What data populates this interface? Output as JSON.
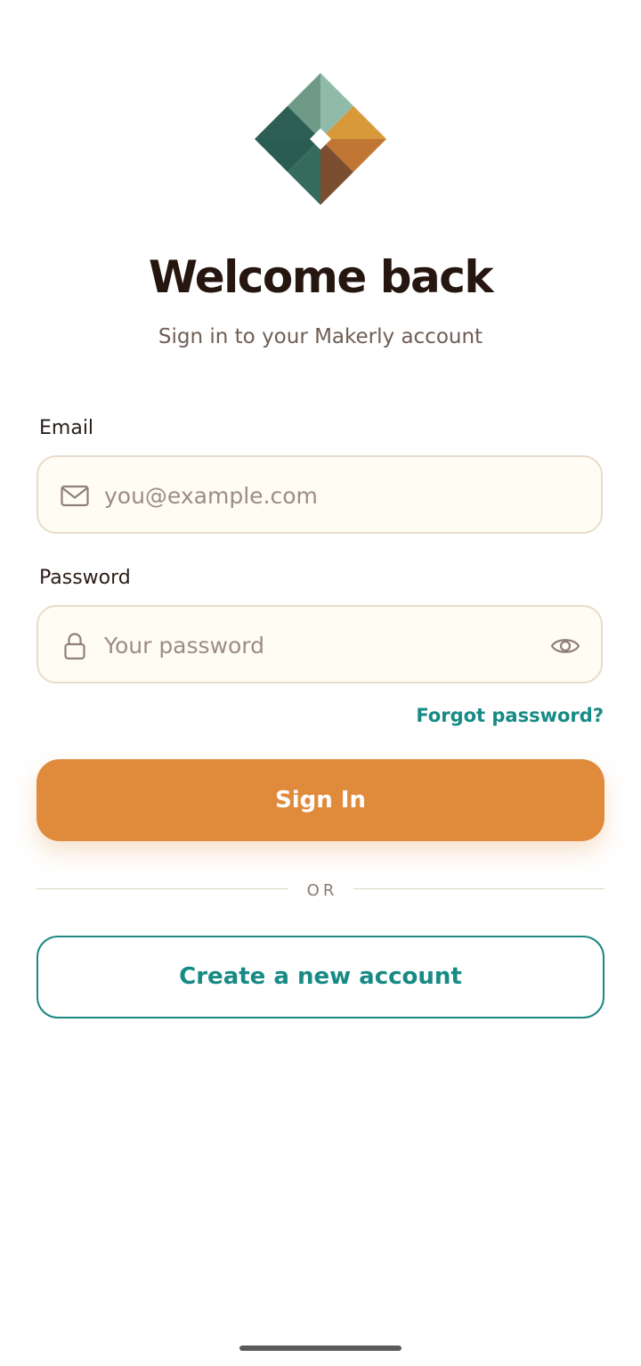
{
  "brand": {
    "logo_icon": "makerly-diamond-logo",
    "colors": {
      "accent": "#e08b3c",
      "teal": "#178a85",
      "text": "#25160f",
      "muted": "#6e5e55",
      "field_bg": "#fffcf4",
      "field_border": "#e6dccb"
    }
  },
  "header": {
    "title": "Welcome back",
    "subtitle": "Sign in to your Makerly account"
  },
  "form": {
    "email": {
      "label": "Email",
      "placeholder": "you@example.com",
      "value": "",
      "icon": "mail-icon"
    },
    "password": {
      "label": "Password",
      "placeholder": "Your password",
      "value": "",
      "icon": "lock-icon",
      "toggle_icon": "eye-icon"
    },
    "forgot_label": "Forgot password?",
    "submit_label": "Sign In"
  },
  "divider": {
    "label": "OR"
  },
  "secondary": {
    "create_label": "Create a new account"
  }
}
